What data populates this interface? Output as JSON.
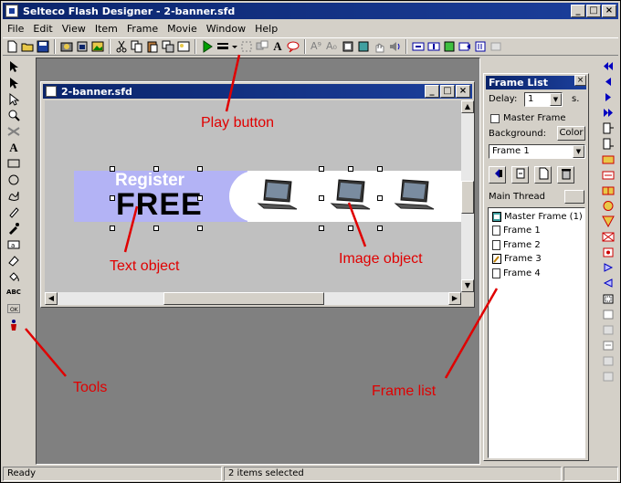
{
  "window": {
    "title": "Selteco Flash Designer - 2-banner.sfd",
    "min": "_",
    "max": "□",
    "close": "×"
  },
  "menu": [
    "File",
    "Edit",
    "View",
    "Item",
    "Frame",
    "Movie",
    "Window",
    "Help"
  ],
  "document": {
    "title": "2-banner.sfd"
  },
  "banner": {
    "register": "Register",
    "free": "FREE"
  },
  "frame_list": {
    "title": "Frame List",
    "delay_label": "Delay:",
    "delay_value": "1",
    "delay_unit": "s.",
    "master_frame_label": "Master Frame",
    "background_label": "Background:",
    "color_button": "Color",
    "frame_select": "Frame 1",
    "main_thread_label": "Main Thread",
    "items": [
      "Master Frame (1)",
      "Frame 1",
      "Frame 2",
      "Frame 3",
      "Frame 4"
    ]
  },
  "status": {
    "left": "Ready",
    "middle": "2 items selected"
  },
  "annotations": {
    "play_button": "Play button",
    "text_object": "Text object",
    "image_object": "Image object",
    "tools": "Tools",
    "frame_list": "Frame list"
  },
  "colors": {
    "annotation": "#e00000",
    "banner_left": "#b3b3f5",
    "titlebar": "#0a246a"
  }
}
